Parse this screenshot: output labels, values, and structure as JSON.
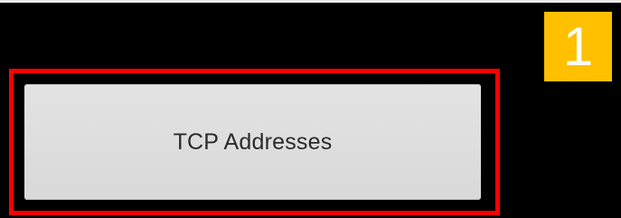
{
  "step_badge": {
    "number": "1",
    "color": "#ffc000"
  },
  "highlight": {
    "color": "#ff0000"
  },
  "tcp_button": {
    "label": "TCP Addresses"
  }
}
